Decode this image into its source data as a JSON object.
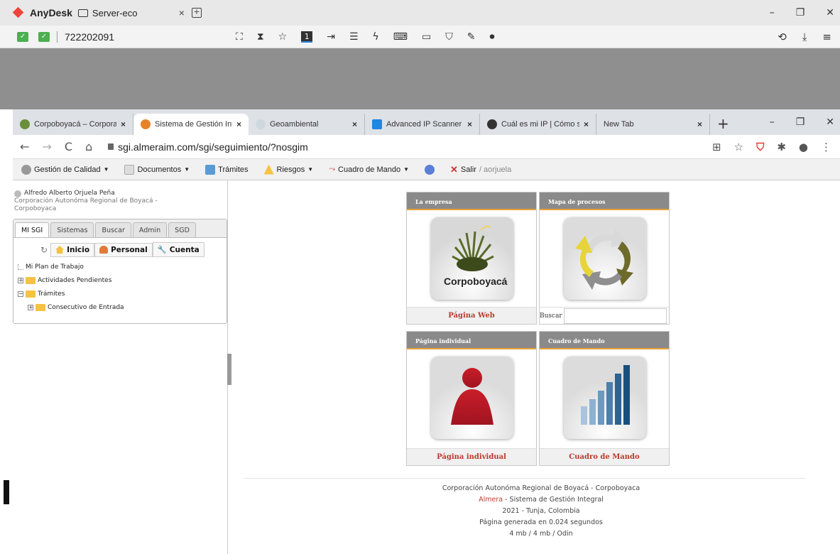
{
  "anydesk": {
    "app_name": "AnyDesk",
    "tab_label": "Server-eco",
    "tab_close": "×",
    "session_id": "722202091",
    "win_min": "–",
    "win_restore": "❐",
    "win_close": "✕"
  },
  "chrome": {
    "tabs": [
      {
        "label": "Corpoboyacá – Corpora",
        "color": "#6a8f3a"
      },
      {
        "label": "Sistema de Gestión Inte",
        "color": "#e6832a"
      },
      {
        "label": "Geoambiental",
        "color": "#cfd8dc"
      },
      {
        "label": "Advanced IP Scanner –",
        "color": "#1e88e5"
      },
      {
        "label": "Cuál es mi IP | Cómo sa",
        "color": "#333333"
      },
      {
        "label": "New Tab",
        "color": "#ffffff"
      }
    ],
    "tab_close": "×",
    "new_tab": "+",
    "url": "sgi.almeraim.com/sgi/seguimiento/?nosgim"
  },
  "toolbar": {
    "items": [
      {
        "label": "Gestión de Calidad",
        "caret": true
      },
      {
        "label": "Documentos",
        "caret": true
      },
      {
        "label": "Trámites",
        "caret": false
      },
      {
        "label": "Riesgos",
        "caret": true
      },
      {
        "label": "Cuadro de Mando",
        "caret": true
      }
    ],
    "salir": "Salir",
    "user_suffix": "/ aorjuela"
  },
  "user": {
    "name": "Alfredo Alberto Orjuela Peña",
    "org_line1": "Corporación Autonóma Regional de Boyacá -",
    "org_line2": "Corpoboyaca"
  },
  "panel": {
    "tabs": [
      "MI SGI",
      "Sistemas",
      "Buscar",
      "Admin",
      "SGD"
    ],
    "buttons": {
      "inicio": "Inicio",
      "personal": "Personal",
      "cuenta": "Cuenta"
    },
    "tree": {
      "plan": "Mi Plan de Trabajo",
      "actividades": "Actividades Pendientes",
      "tramites": "Trámites",
      "consecutivo": "Consecutivo de Entrada"
    }
  },
  "cards": {
    "empresa": {
      "header": "La empresa",
      "footer": "Página Web",
      "logo_text": "Corpoboyacá"
    },
    "mapa": {
      "header": "Mapa de procesos",
      "search_label": "Buscar"
    },
    "individual": {
      "header": "Página individual",
      "footer": "Página individual"
    },
    "cuadro": {
      "header": "Cuadro de Mando",
      "footer": "Cuadro de Mando"
    }
  },
  "footer": {
    "line1": "Corporación Autonóma Regional de Boyacá - Corpoboyaca",
    "almera": "Almera",
    "line2_rest": " - Sistema de Gestión Integral",
    "line3": "2021 - Tunja, Colombia",
    "line4": "Página generada en 0.024 segundos",
    "line5": "4 mb / 4 mb / Odin"
  },
  "colors": {
    "accent_orange": "#e8a33a",
    "card_header": "#8a8a8a",
    "link_red": "#b83a2b"
  }
}
